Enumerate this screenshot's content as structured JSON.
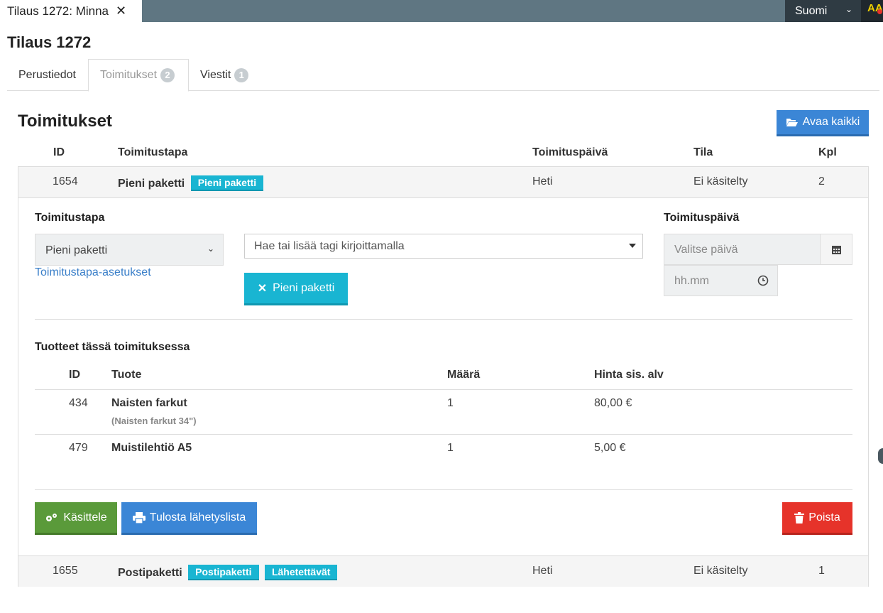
{
  "doc_tab": {
    "label": "Tilaus 1272: Minna",
    "close": "✕"
  },
  "lang": {
    "label": "Suomi"
  },
  "a11y": {
    "label": "AA"
  },
  "page_title": "Tilaus 1272",
  "tabs": [
    {
      "label": "Perustiedot",
      "count": ""
    },
    {
      "label": "Toimitukset",
      "count": "2"
    },
    {
      "label": "Viestit",
      "count": "1"
    }
  ],
  "section": {
    "title": "Toimitukset",
    "open_all": "Avaa kaikki"
  },
  "table": {
    "headers": [
      "ID",
      "Toimitustapa",
      "Toimituspäivä",
      "Tila",
      "Kpl"
    ],
    "rows": [
      {
        "id": "1654",
        "method": "Pieni paketti",
        "tags": [
          "Pieni paketti"
        ],
        "date": "Heti",
        "status": "Ei käsitelty",
        "qty": "2"
      },
      {
        "id": "1655",
        "method": "Postipaketti",
        "tags": [
          "Postipaketti",
          "Lähetettävät"
        ],
        "date": "Heti",
        "status": "Ei käsitelty",
        "qty": "1"
      }
    ]
  },
  "detail": {
    "method_label": "Toimitustapa",
    "method_value": "Pieni paketti",
    "method_settings": "Toimitustapa-asetukset",
    "tag_placeholder": "Hae tai lisää tagi kirjoittamalla",
    "tag_button": "Pieni paketti",
    "date_label": "Toimituspäivä",
    "date_placeholder": "Valitse päivä",
    "time_placeholder": "hh.mm",
    "products_title": "Tuotteet tässä toimituksessa",
    "product_headers": [
      "ID",
      "Tuote",
      "Määrä",
      "Hinta sis. alv"
    ],
    "products": [
      {
        "id": "434",
        "name": "Naisten farkut",
        "variant": "(Naisten farkut 34\")",
        "qty": "1",
        "price": "80,00 €"
      },
      {
        "id": "479",
        "name": "Muistilehtiö A5",
        "variant": "",
        "qty": "1",
        "price": "5,00 €"
      }
    ],
    "actions": {
      "process": "Käsittele",
      "print": "Tulosta lähetyslista",
      "delete": "Poista"
    }
  },
  "colors": {
    "topbar": "#5f7682",
    "primary": "#3b86d6",
    "info": "#19b5d2",
    "success": "#5a9a3a",
    "danger": "#e6332a"
  }
}
